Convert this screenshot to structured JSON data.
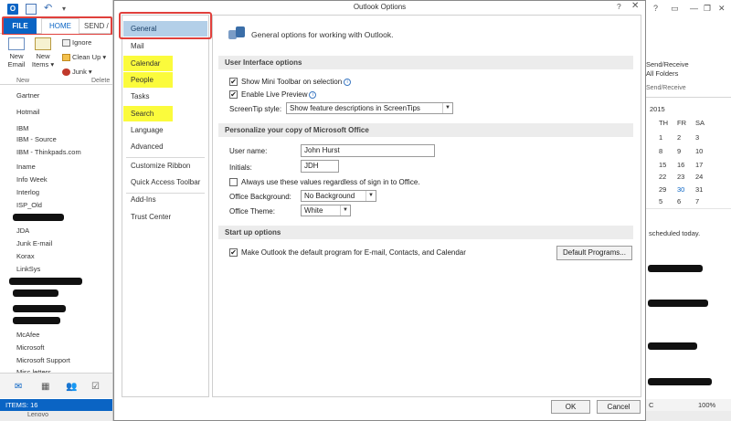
{
  "left_window": {
    "qat": {
      "app_icon": "O",
      "undo_glyph": "↶",
      "more_glyph": "▾"
    },
    "tabs": {
      "file": "FILE",
      "home": "HOME",
      "send": "SEND /"
    },
    "ribbon": {
      "new_email": "New Email",
      "new_items": "New Items ▾",
      "ignore": "Ignore",
      "clean_up": "Clean Up ▾",
      "junk": "Junk ▾",
      "group_new": "New",
      "group_delete": "Delete"
    },
    "folders": [
      "Gartner",
      "Hotmail",
      "IBM",
      "IBM - Source",
      "IBM - Thinkpads.com",
      "Iname",
      "Info Week",
      "Interlog",
      "ISP_Old",
      "JDA",
      "Junk E-mail",
      "Korax",
      "LinkSys",
      "McAfee",
      "Microsoft",
      "Microsoft Support",
      "Misc letters"
    ],
    "nav_icons": {
      "mail": "✉",
      "calendar": "▦",
      "people": "👥",
      "tasks": "☑"
    },
    "status": "ITEMS: 16",
    "taskbar": "Lenovo"
  },
  "right_window": {
    "controls": {
      "help": "?",
      "ribbon_options": "▭",
      "minimize": "—",
      "restore": "❐",
      "close": "✕"
    },
    "send_receive_line1": "Send/Receive",
    "send_receive_line2": "All Folders",
    "group_label": "Send/Receive",
    "calendar": {
      "year": "2015",
      "day_heads": [
        "TH",
        "FR",
        "SA"
      ],
      "rows": [
        [
          "1",
          "2",
          "3"
        ],
        [
          "8",
          "9",
          "10"
        ],
        [
          "15",
          "16",
          "17"
        ],
        [
          "22",
          "23",
          "24"
        ],
        [
          "29",
          "30",
          "31"
        ],
        [
          "5",
          "6",
          "7"
        ]
      ],
      "today": "30",
      "today_marker": "1"
    },
    "scheduled": "scheduled today.",
    "status_initial": "C",
    "zoom": "100%"
  },
  "dialog": {
    "title": "Outlook Options",
    "help_glyph": "?",
    "close_glyph": "✕",
    "nav_items": [
      {
        "label": "General"
      },
      {
        "label": "Mail"
      },
      {
        "label": "Calendar"
      },
      {
        "label": "People"
      },
      {
        "label": "Tasks"
      },
      {
        "label": "Search"
      },
      {
        "label": "Language"
      },
      {
        "label": "Advanced"
      },
      {
        "label": "Customize Ribbon"
      },
      {
        "label": "Quick Access Toolbar"
      },
      {
        "label": "Add-Ins"
      },
      {
        "label": "Trust Center"
      }
    ],
    "header": "General options for working with Outlook.",
    "sections": {
      "ui": "User Interface options",
      "personalize": "Personalize your copy of Microsoft Office",
      "startup": "Start up options"
    },
    "ui_options": {
      "mini_toolbar": "Show Mini Toolbar on selection",
      "live_preview": "Enable Live Preview",
      "screentip_label": "ScreenTip style:",
      "screentip_value": "Show feature descriptions in ScreenTips"
    },
    "personalize": {
      "user_name_label": "User name:",
      "user_name_value": "John Hurst",
      "initials_label": "Initials:",
      "initials_value": "JDH",
      "always_use": "Always use these values regardless of sign in to Office.",
      "background_label": "Office Background:",
      "background_value": "No Background",
      "theme_label": "Office Theme:",
      "theme_value": "White"
    },
    "startup": {
      "make_default": "Make Outlook the default program for E-mail, Contacts, and Calendar",
      "default_programs_button": "Default Programs..."
    },
    "buttons": {
      "ok": "OK",
      "cancel": "Cancel"
    }
  },
  "colors": {
    "accent_blue": "#0a64c4",
    "selected_nav": "#b3cfe8",
    "highlight_yellow": "#fbfb3c",
    "annotation_red": "#e0403c"
  }
}
